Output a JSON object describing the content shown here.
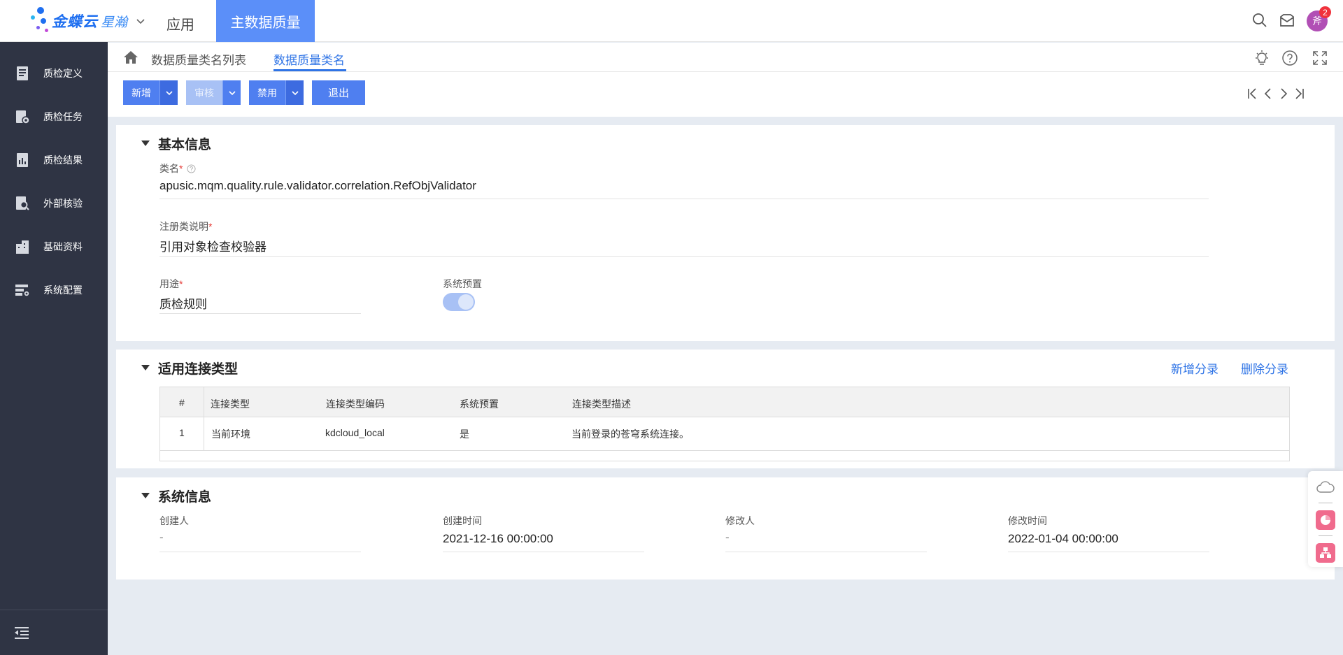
{
  "header": {
    "brand": "金蝶云",
    "brand_sub": "星瀚",
    "app_menu": "应用",
    "active_app": "主数据质量",
    "notification_count": "2",
    "avatar_text": "斧"
  },
  "sidebar": {
    "items": [
      {
        "label": "质检定义",
        "icon": "book-icon"
      },
      {
        "label": "质检任务",
        "icon": "task-gear-icon"
      },
      {
        "label": "质检结果",
        "icon": "report-icon"
      },
      {
        "label": "外部核验",
        "icon": "search-doc-icon"
      },
      {
        "label": "基础资料",
        "icon": "building-icon"
      },
      {
        "label": "系统配置",
        "icon": "config-icon"
      }
    ]
  },
  "breadcrumb": {
    "list": "数据质量类名列表",
    "current": "数据质量类名"
  },
  "toolbar": {
    "new_label": "新增",
    "audit_label": "审核",
    "disable_label": "禁用",
    "exit_label": "退出"
  },
  "basic_info": {
    "title": "基本信息",
    "class_name_label": "类名",
    "class_name_value": "apusic.mqm.quality.rule.validator.correlation.RefObjValidator",
    "desc_label": "注册类说明",
    "desc_value": "引用对象检查校验器",
    "usage_label": "用途",
    "usage_value": "质检规则",
    "preset_label": "系统预置",
    "preset_on": true
  },
  "connection": {
    "title": "适用连接类型",
    "add_link": "新增分录",
    "delete_link": "删除分录",
    "columns": [
      "#",
      "连接类型",
      "连接类型编码",
      "系统预置",
      "连接类型描述"
    ],
    "rows": [
      [
        "1",
        "当前环境",
        "kdcloud_local",
        "是",
        "当前登录的苍穹系统连接。"
      ]
    ]
  },
  "system_info": {
    "title": "系统信息",
    "creator_label": "创建人",
    "creator_value": "-",
    "created_label": "创建时间",
    "created_value": "2021-12-16 00:00:00",
    "modifier_label": "修改人",
    "modifier_value": "-",
    "modified_label": "修改时间",
    "modified_value": "2022-01-04 00:00:00"
  },
  "colors": {
    "primary": "#4f7ff0",
    "sidebar_bg": "#2f3444",
    "active_tab": "#5b8ff9",
    "link": "#2f74e6"
  }
}
